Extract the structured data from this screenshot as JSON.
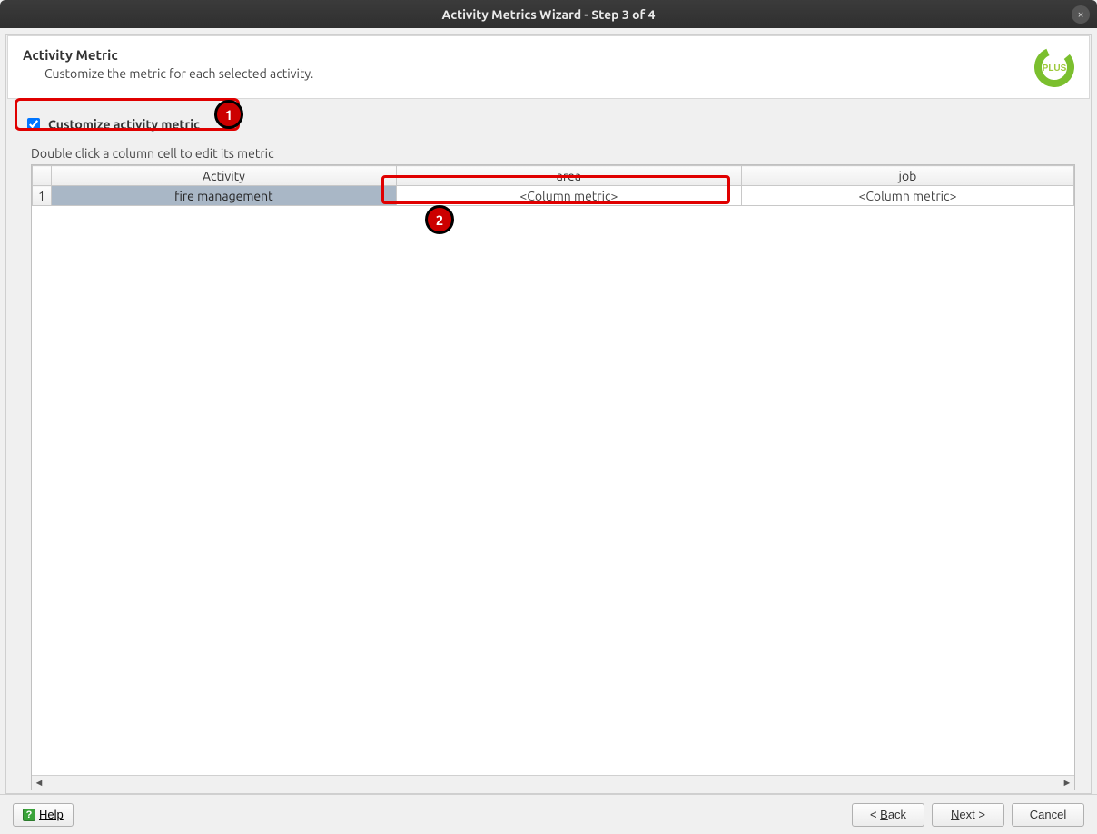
{
  "window": {
    "title": "Activity Metrics Wizard - Step 3 of 4",
    "close_label": "×"
  },
  "header": {
    "title": "Activity Metric",
    "subtitle": "Customize the metric for each selected activity."
  },
  "checkbox": {
    "label": "Customize activity metric",
    "checked": true
  },
  "annotations": {
    "badge1": "1",
    "badge2": "2"
  },
  "instruction": "Double click a column cell to edit its metric",
  "table": {
    "columns": [
      "Activity",
      "area",
      "job"
    ],
    "rows": [
      {
        "num": "1",
        "activity": "fire management",
        "area": "<Column metric>",
        "job": "<Column metric>"
      }
    ]
  },
  "footer": {
    "help": "Help",
    "back": "< Back",
    "back_ul": "B",
    "next": "Next >",
    "next_ul": "N",
    "cancel": "Cancel"
  }
}
